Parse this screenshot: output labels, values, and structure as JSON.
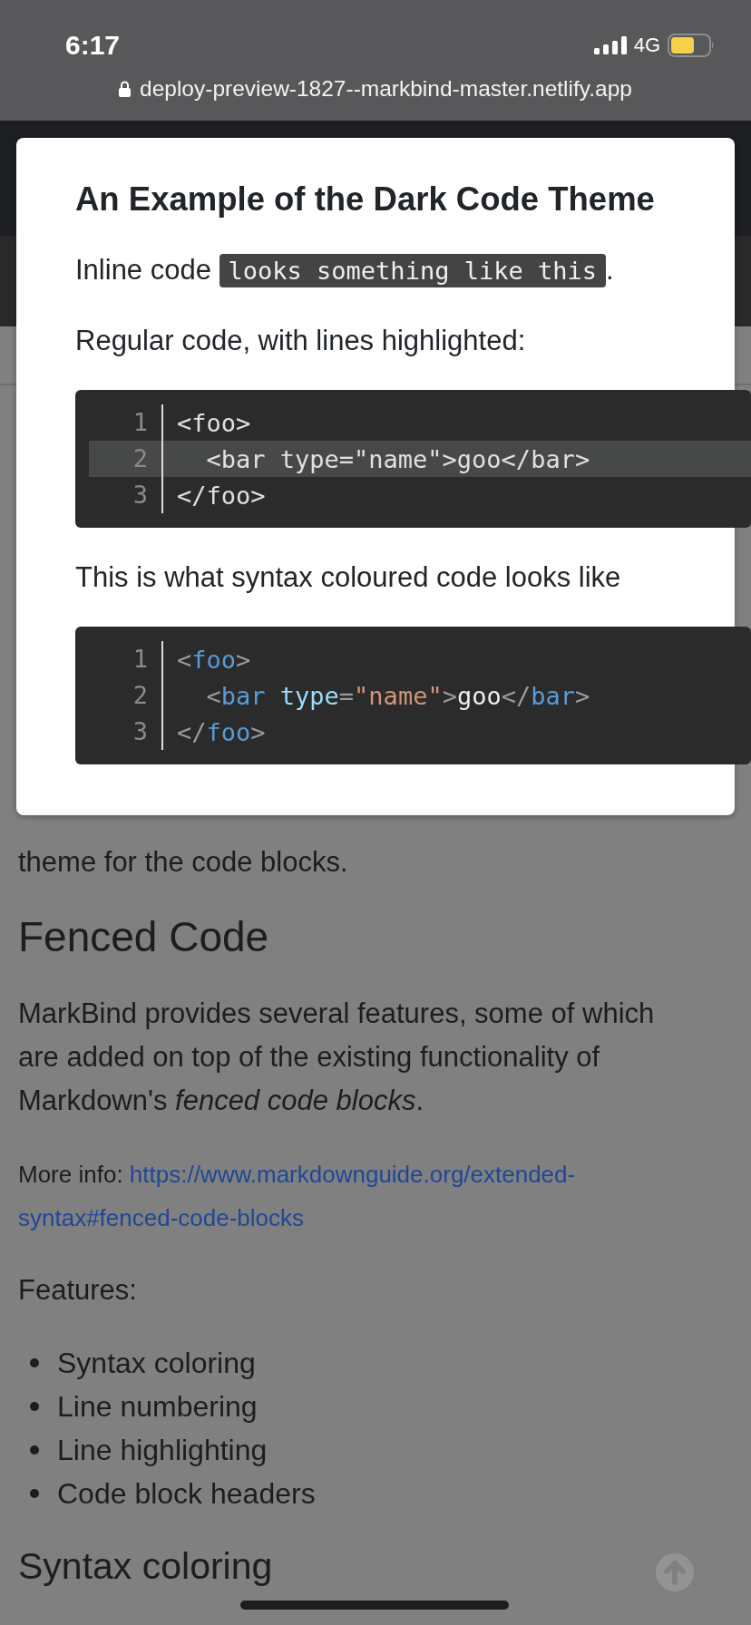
{
  "status_bar": {
    "time": "6:17",
    "network": "4G"
  },
  "address_bar": {
    "url": "deploy-preview-1827--markbind-master.netlify.app"
  },
  "modal": {
    "title": "An Example of the Dark Code Theme",
    "blocks": [
      {
        "kind": "inline_code_paragraph",
        "prefix": "Inline code ",
        "code": "looks something like this",
        "suffix": "."
      },
      {
        "kind": "paragraph",
        "text": "Regular code, with lines highlighted:"
      },
      {
        "kind": "code",
        "lines": [
          {
            "number": "1",
            "highlighted": false,
            "tokens": [
              {
                "text": "<foo>",
                "kind": "plain"
              }
            ]
          },
          {
            "number": "2",
            "highlighted": true,
            "tokens": [
              {
                "text": "  <bar type=\"name\">goo</bar>",
                "kind": "plain"
              }
            ]
          },
          {
            "number": "3",
            "highlighted": false,
            "tokens": [
              {
                "text": "</foo>",
                "kind": "plain"
              }
            ]
          }
        ]
      },
      {
        "kind": "paragraph",
        "text": "This is what syntax coloured code looks like"
      },
      {
        "kind": "code",
        "lines": [
          {
            "number": "1",
            "highlighted": false,
            "tokens": [
              {
                "text": "<",
                "kind": "punct"
              },
              {
                "text": "foo",
                "kind": "tag"
              },
              {
                "text": ">",
                "kind": "punct"
              }
            ]
          },
          {
            "number": "2",
            "highlighted": false,
            "tokens": [
              {
                "text": "  <",
                "kind": "punct"
              },
              {
                "text": "bar",
                "kind": "tag"
              },
              {
                "text": " type",
                "kind": "attr"
              },
              {
                "text": "=",
                "kind": "punct"
              },
              {
                "text": "\"name\"",
                "kind": "string"
              },
              {
                "text": ">",
                "kind": "punct"
              },
              {
                "text": "goo",
                "kind": "text"
              },
              {
                "text": "</",
                "kind": "punct"
              },
              {
                "text": "bar",
                "kind": "tag"
              },
              {
                "text": ">",
                "kind": "punct"
              }
            ]
          },
          {
            "number": "3",
            "highlighted": false,
            "tokens": [
              {
                "text": "</",
                "kind": "punct"
              },
              {
                "text": "foo",
                "kind": "tag"
              },
              {
                "text": ">",
                "kind": "punct"
              }
            ]
          }
        ]
      }
    ]
  },
  "content": [
    {
      "kind": "paragraph",
      "parts": [
        {
          "text": "theme for the code blocks.",
          "kind": "text"
        }
      ]
    },
    {
      "kind": "heading",
      "text": "Fenced Code"
    },
    {
      "kind": "paragraph",
      "parts": [
        {
          "text": "MarkBind provides several features, some of which are added on top of the existing functionality of Markdown's *fenced code blocks*.",
          "kind": "text"
        }
      ]
    },
    {
      "kind": "small_paragraph",
      "parts": [
        {
          "text": "More info: ",
          "kind": "text"
        },
        {
          "text": "https://www.markdownguide.org/extended-",
          "kind": "link"
        },
        {
          "text": "syntax#fenced-code-blocks",
          "kind": "link"
        }
      ]
    },
    {
      "kind": "paragraph",
      "parts": [
        {
          "text": "Features:",
          "kind": "text"
        }
      ]
    },
    {
      "kind": "list",
      "items": [
        "Syntax coloring",
        "Line numbering",
        "Line highlighting",
        "Code block headers"
      ]
    },
    {
      "kind": "subheading",
      "text": "Syntax coloring"
    }
  ]
}
